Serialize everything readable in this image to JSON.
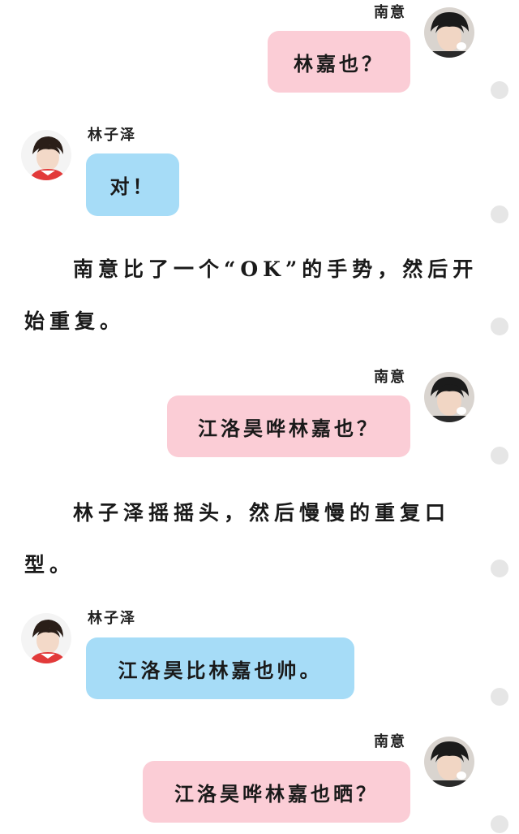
{
  "messages": [
    {
      "sender": "南意",
      "side": "right",
      "text": "林嘉也？"
    },
    {
      "sender": "林子泽",
      "side": "left",
      "text": "对！"
    },
    {
      "sender": "南意",
      "side": "right",
      "text": "江洛昊哗林嘉也？"
    },
    {
      "sender": "林子泽",
      "side": "left",
      "text": "江洛昊比林嘉也帅。"
    },
    {
      "sender": "南意",
      "side": "right",
      "text": "江洛昊哗林嘉也晒？"
    }
  ],
  "narration": [
    "南意比了一个“OK”的手势，然后开始重复。",
    "林子泽摇摇头，然后慢慢的重复口型。"
  ],
  "colors": {
    "pink_bubble": "#fbcdd6",
    "blue_bubble": "#a6dcf7",
    "side_dot": "#e6e6e6"
  }
}
